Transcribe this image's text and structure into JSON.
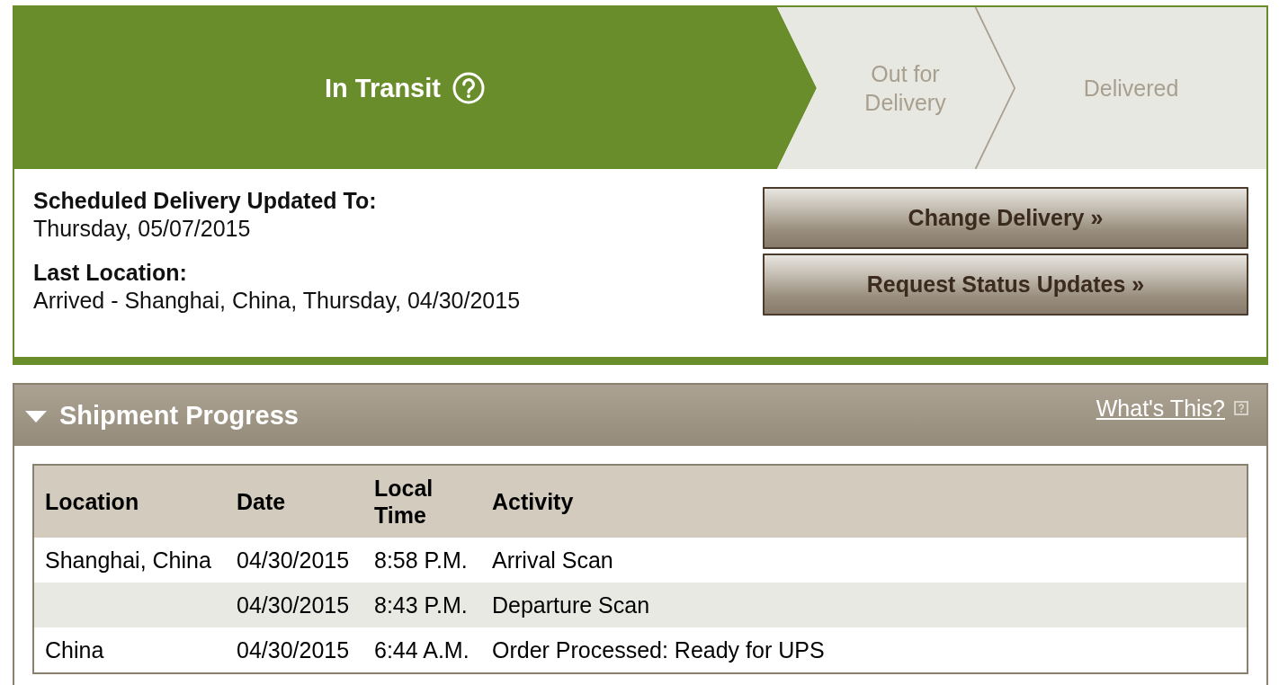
{
  "tracker": {
    "stages": [
      {
        "label": "In Transit",
        "selected": true
      },
      {
        "label": "Out for Delivery",
        "selected": false
      },
      {
        "label": "Delivered",
        "selected": false
      }
    ]
  },
  "delivery": {
    "fields": [
      {
        "label": "Scheduled Delivery Updated To:",
        "value": "Thursday, 05/07/2015"
      },
      {
        "label": "Last Location:",
        "value": "Arrived - Shanghai, China, Thursday, 04/30/2015"
      }
    ],
    "actions": [
      "Change Delivery »",
      "Request Status Updates »"
    ]
  },
  "shipment_progress": {
    "title": "Shipment Progress",
    "expanded": true,
    "help_link": "What's This?",
    "table": {
      "columns": [
        "Location",
        "Date",
        "Local Time",
        "Activity"
      ],
      "rows": [
        {
          "location": "Shanghai, China",
          "date": "04/30/2015",
          "local_time": "8:58 P.M.",
          "activity": "Arrival Scan"
        },
        {
          "date": "04/30/2015",
          "local_time": "8:43 P.M.",
          "activity": "Departure Scan"
        },
        {
          "location": "China",
          "date": "04/30/2015",
          "local_time": "6:44 A.M.",
          "activity": "Order Processed: Ready for UPS"
        }
      ]
    }
  }
}
